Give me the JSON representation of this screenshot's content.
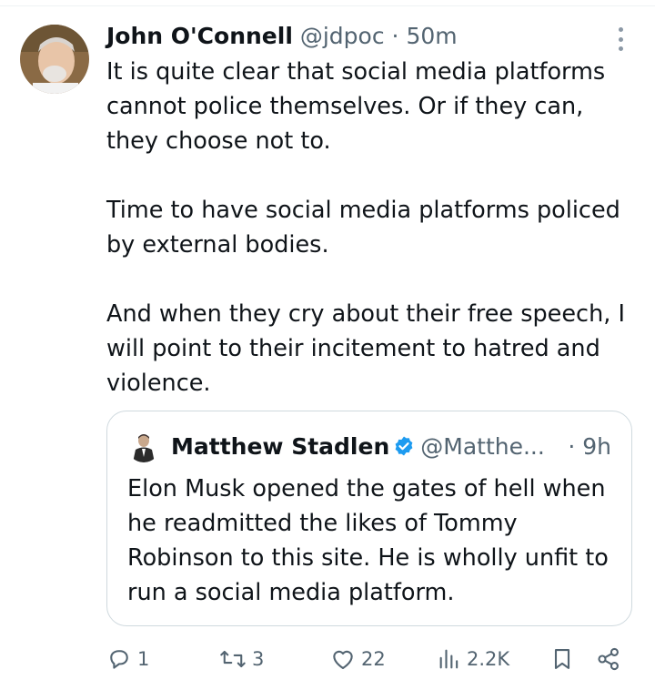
{
  "tweet": {
    "author_name": "John O'Connell",
    "handle": "@jdpoc",
    "separator": "·",
    "time": "50m",
    "paragraphs": [
      "It is quite clear that social media platforms cannot police themselves. Or if they can, they choose not to.",
      "Time to have social media platforms policed by external bodies.",
      "And when they cry about their free speech, I will point to their incitement to hatred and violence."
    ]
  },
  "quote": {
    "author_name": "Matthew Stadlen",
    "handle": "@Matthe...",
    "separator": "·",
    "time": "9h",
    "text": "Elon Musk opened the gates of hell when he readmitted the likes of Tommy Robinson to this site. He is wholly unfit to run a social media platform."
  },
  "actions": {
    "replies": "1",
    "reposts": "3",
    "likes": "22",
    "views": "2.2K"
  },
  "colors": {
    "text": "#0f1419",
    "muted": "#536471",
    "border": "#cfd9de",
    "verified": "#1d9bf0"
  }
}
